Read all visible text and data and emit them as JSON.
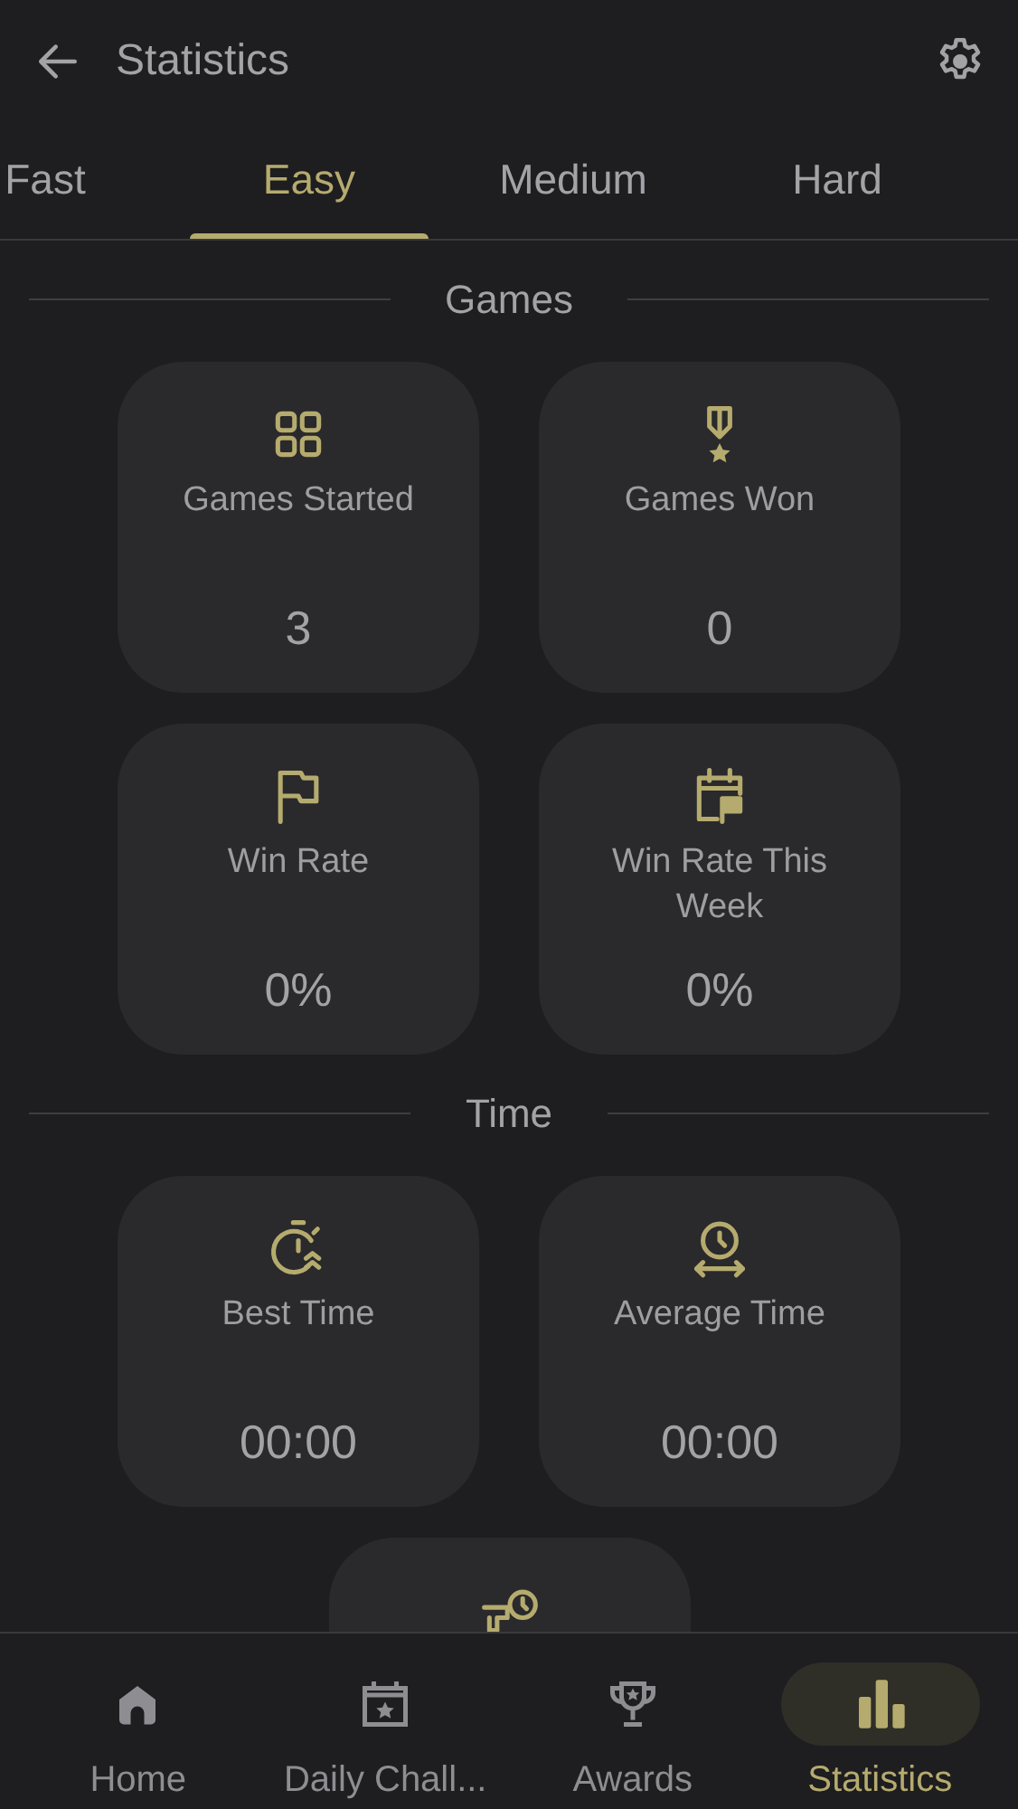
{
  "header": {
    "title": "Statistics"
  },
  "tabs": [
    {
      "label": "Fast",
      "selected": false
    },
    {
      "label": "Easy",
      "selected": true
    },
    {
      "label": "Medium",
      "selected": false
    },
    {
      "label": "Hard",
      "selected": false
    }
  ],
  "sections": [
    {
      "title": "Games",
      "cards": [
        {
          "kind": "stat",
          "label": "Games Started",
          "value": "3"
        },
        {
          "kind": "stat",
          "label": "Games Won",
          "value": "0"
        },
        {
          "kind": "stat",
          "label": "Win Rate",
          "value": "0%"
        },
        {
          "kind": "stat",
          "label": "Win Rate This Week",
          "value": "0%"
        }
      ]
    },
    {
      "title": "Time",
      "cards": [
        {
          "kind": "stat",
          "label": "Best Time",
          "value": "00:00"
        },
        {
          "kind": "stat",
          "label": "Average Time",
          "value": "00:00"
        },
        {
          "kind": "icon_only"
        }
      ]
    }
  ],
  "bottom_nav": [
    {
      "label": "Home",
      "selected": false
    },
    {
      "label": "Daily Chall...",
      "selected": false
    },
    {
      "label": "Awards",
      "selected": false
    },
    {
      "label": "Statistics",
      "selected": true
    }
  ]
}
